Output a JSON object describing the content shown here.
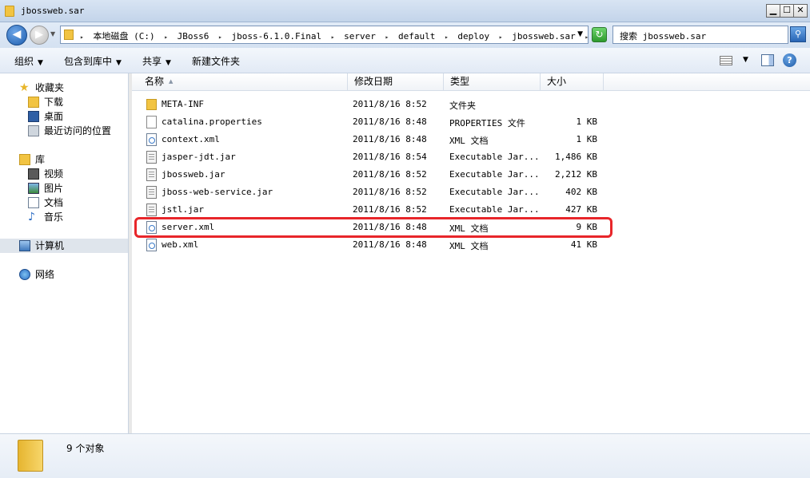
{
  "window": {
    "title": "jbossweb.sar",
    "controls": {
      "minimize": "▁",
      "maximize": "☐",
      "close": "✕"
    }
  },
  "address": {
    "breadcrumbs": [
      "本地磁盘 (C:)",
      "JBoss6",
      "jboss-6.1.0.Final",
      "server",
      "default",
      "deploy",
      "jbossweb.sar"
    ],
    "search_placeholder": "搜索 jbossweb.sar"
  },
  "toolbar": {
    "organize": "组织",
    "include_in_library": "包含到库中",
    "share": "共享",
    "new_folder": "新建文件夹"
  },
  "nav": {
    "favorites": "收藏夹",
    "downloads": "下载",
    "desktop": "桌面",
    "recent": "最近访问的位置",
    "libraries": "库",
    "videos": "视频",
    "pictures": "图片",
    "documents": "文档",
    "music": "音乐",
    "computer": "计算机",
    "network": "网络"
  },
  "columns": {
    "name": "名称",
    "date": "修改日期",
    "type": "类型",
    "size": "大小"
  },
  "files": [
    {
      "name": "META-INF",
      "date": "2011/8/16 8:52",
      "type": "文件夹",
      "size": "",
      "icon": "folder"
    },
    {
      "name": "catalina.properties",
      "date": "2011/8/16 8:48",
      "type": "PROPERTIES 文件",
      "size": "1 KB",
      "icon": "doc"
    },
    {
      "name": "context.xml",
      "date": "2011/8/16 8:48",
      "type": "XML 文档",
      "size": "1 KB",
      "icon": "xml"
    },
    {
      "name": "jasper-jdt.jar",
      "date": "2011/8/16 8:54",
      "type": "Executable Jar...",
      "size": "1,486 KB",
      "icon": "jar"
    },
    {
      "name": "jbossweb.jar",
      "date": "2011/8/16 8:52",
      "type": "Executable Jar...",
      "size": "2,212 KB",
      "icon": "jar"
    },
    {
      "name": "jboss-web-service.jar",
      "date": "2011/8/16 8:52",
      "type": "Executable Jar...",
      "size": "402 KB",
      "icon": "jar"
    },
    {
      "name": "jstl.jar",
      "date": "2011/8/16 8:52",
      "type": "Executable Jar...",
      "size": "427 KB",
      "icon": "jar"
    },
    {
      "name": "server.xml",
      "date": "2011/8/16 8:48",
      "type": "XML 文档",
      "size": "9 KB",
      "icon": "xml"
    },
    {
      "name": "web.xml",
      "date": "2011/8/16 8:48",
      "type": "XML 文档",
      "size": "41 KB",
      "icon": "xml"
    }
  ],
  "status": {
    "count": "9 个对象"
  }
}
